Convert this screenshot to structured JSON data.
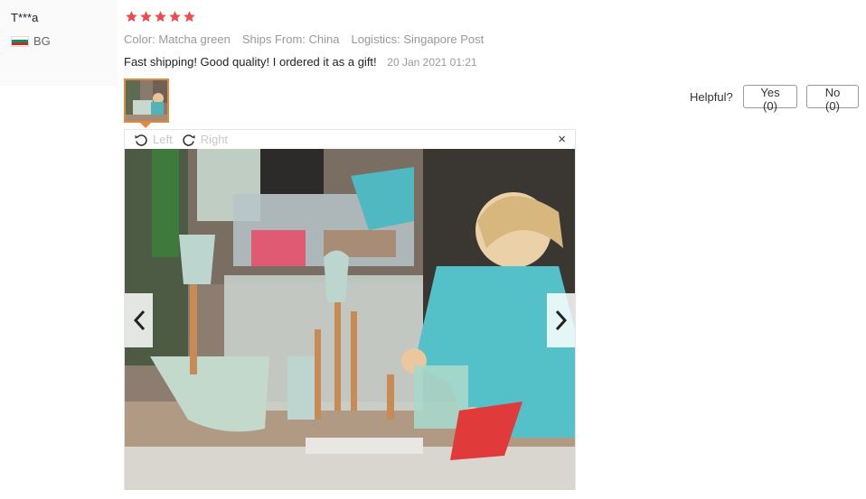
{
  "reviewer": {
    "name": "T***a",
    "country": "BG",
    "flag_colors": [
      "#ffffff",
      "#00966e",
      "#d62612"
    ]
  },
  "rating": {
    "value": 5,
    "max": 5,
    "star_color": "#f04a4a"
  },
  "meta": {
    "color_label": "Color:",
    "color_value": "Matcha green",
    "ships_label": "Ships From:",
    "ships_value": "China",
    "logistics_label": "Logistics:",
    "logistics_value": "Singapore Post"
  },
  "review": {
    "text": "Fast shipping! Good quality! I ordered it as a gift!",
    "date": "20 Jan 2021 01:21"
  },
  "helpful": {
    "label": "Helpful?",
    "yes_label": "Yes (0)",
    "no_label": "No (0)"
  },
  "viewer": {
    "rotate_left_label": "Left",
    "rotate_right_label": "Right",
    "close_symbol": "×",
    "thumbnail_border_color": "#e4883c"
  },
  "icons": {
    "star": "star-icon",
    "rotate_left": "rotate-left-icon",
    "rotate_right": "rotate-right-icon",
    "close": "close-icon",
    "prev": "chevron-left-icon",
    "next": "chevron-right-icon"
  }
}
